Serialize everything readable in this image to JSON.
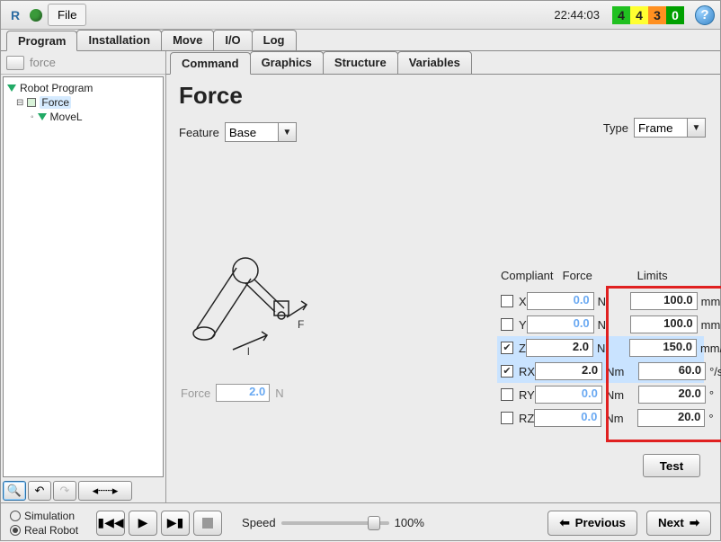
{
  "menubar": {
    "file_label": "File",
    "clock": "22:44:03"
  },
  "chips": [
    "4",
    "4",
    "3",
    "0"
  ],
  "main_tabs": [
    "Program",
    "Installation",
    "Move",
    "I/O",
    "Log"
  ],
  "main_active": 0,
  "filebar": {
    "name": "force"
  },
  "tree": {
    "root": "Robot Program",
    "force": "Force",
    "movel": "MoveL"
  },
  "sub_tabs": [
    "Command",
    "Graphics",
    "Structure",
    "Variables"
  ],
  "sub_active": 0,
  "panel": {
    "title": "Force",
    "feature_label": "Feature",
    "feature_value": "Base",
    "type_label": "Type",
    "type_value": "Frame",
    "diagram_force_label": "Force",
    "diagram_force_value": "2.0",
    "diagram_force_unit": "N",
    "col_compliant": "Compliant",
    "col_force": "Force",
    "col_limits": "Limits",
    "axes": [
      {
        "name": "X",
        "compliant": false,
        "force": "0.0",
        "funit": "N",
        "limit": "100.0",
        "lunit": "mm",
        "hl": false
      },
      {
        "name": "Y",
        "compliant": false,
        "force": "0.0",
        "funit": "N",
        "limit": "100.0",
        "lunit": "mm",
        "hl": false
      },
      {
        "name": "Z",
        "compliant": true,
        "force": "2.0",
        "funit": "N",
        "limit": "150.0",
        "lunit": "mm/s",
        "hl": true
      },
      {
        "name": "RX",
        "compliant": true,
        "force": "2.0",
        "funit": "Nm",
        "limit": "60.0",
        "lunit": "°/s",
        "hl": true
      },
      {
        "name": "RY",
        "compliant": false,
        "force": "0.0",
        "funit": "Nm",
        "limit": "20.0",
        "lunit": "°",
        "hl": false
      },
      {
        "name": "RZ",
        "compliant": false,
        "force": "0.0",
        "funit": "Nm",
        "limit": "20.0",
        "lunit": "°",
        "hl": false
      }
    ],
    "test_label": "Test"
  },
  "footer": {
    "simulation": "Simulation",
    "real_robot": "Real Robot",
    "speed_label": "Speed",
    "speed_pct": "100%",
    "prev": "Previous",
    "next": "Next"
  }
}
